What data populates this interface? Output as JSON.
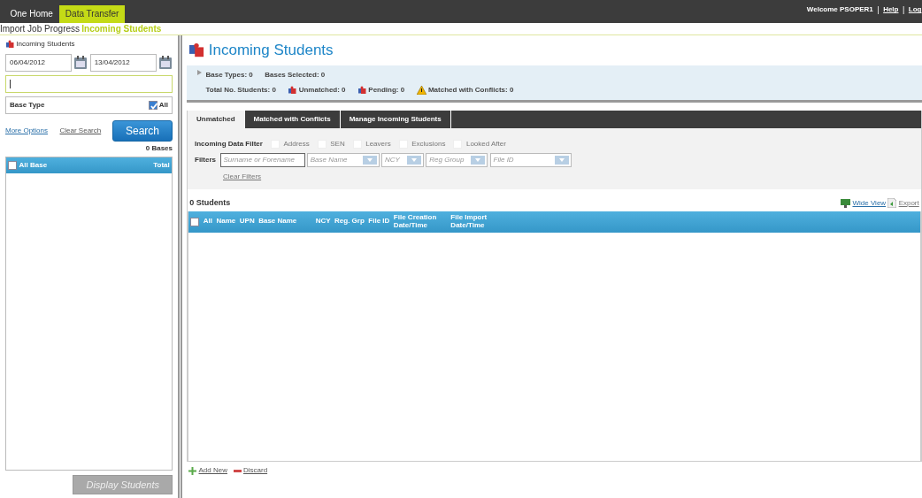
{
  "top_nav": {
    "tabs": [
      {
        "label": "One Home",
        "selected": false
      },
      {
        "label": "Data Transfer",
        "selected": true
      }
    ],
    "welcome": "Welcome  PSOPER1",
    "links": [
      {
        "separator": "|",
        "label": "Help"
      },
      {
        "separator": "|",
        "label": "Log"
      }
    ]
  },
  "breadcrumb": [
    {
      "label": "Import Job Progress",
      "selected": false
    },
    {
      "label": "Incoming Students",
      "selected": true
    }
  ],
  "sidebar": {
    "title": "Incoming Students",
    "date_from": "06/04/2012",
    "date_to": "13/04/2012",
    "base_type": {
      "label": "Base Type",
      "all_label": "All",
      "all_checked": true
    },
    "more_options": "More Options",
    "clear_search": "Clear Search",
    "search_button": "Search",
    "bases_count": "0 Bases",
    "list_header": {
      "checked": false,
      "columns": [
        "All",
        "Base",
        "Total"
      ]
    },
    "display_button": {
      "label": "Display Students",
      "disabled": true
    }
  },
  "main": {
    "title": "Incoming Students",
    "summary": [
      [
        {
          "kind": "plain",
          "label": "Base Types:",
          "value": "0"
        },
        {
          "kind": "plain",
          "label": "Bases Selected:",
          "value": "0"
        }
      ],
      [
        {
          "kind": "plain",
          "label": "Total No. Students:",
          "value": "0"
        },
        {
          "kind": "unmatched",
          "label": "Unmatched:",
          "value": "0"
        },
        {
          "kind": "pending",
          "label": "Pending:",
          "value": "0"
        },
        {
          "kind": "conflict",
          "label": "Matched with Conflicts:",
          "value": "0"
        }
      ]
    ],
    "tabs": [
      {
        "label": "Unmatched",
        "selected": true
      },
      {
        "label": "Matched with Conflicts",
        "selected": false
      },
      {
        "label": "Manage Incoming Students",
        "selected": false
      }
    ],
    "data_filter": {
      "label": "Incoming Data Filter",
      "options": [
        {
          "label": "Address",
          "checked": false
        },
        {
          "label": "SEN",
          "checked": false
        },
        {
          "label": "Leavers",
          "checked": false
        },
        {
          "label": "Exclusions",
          "checked": false
        },
        {
          "label": "Looked After",
          "checked": false
        }
      ]
    },
    "filters": {
      "label": "Filters",
      "fields": [
        {
          "kind": "text",
          "placeholder": "Surname or Forename"
        },
        {
          "kind": "dropdown",
          "placeholder": "Base Name"
        },
        {
          "kind": "dropdown",
          "placeholder": "NCY"
        },
        {
          "kind": "dropdown",
          "placeholder": "Reg Group"
        },
        {
          "kind": "dropdown",
          "placeholder": "File ID"
        }
      ],
      "clear": "Clear Filters"
    },
    "students_count": "0 Students",
    "wide_view": "Wide View",
    "export": "Export",
    "table": {
      "checked": false,
      "columns": [
        "All",
        "Name",
        "UPN",
        "Base Name",
        "NCY",
        "Reg. Grp",
        "File ID",
        "File Creation Date/Time",
        "File Import Date/Time"
      ]
    },
    "footer": {
      "add_new": "Add New",
      "discard": "Discard"
    }
  }
}
